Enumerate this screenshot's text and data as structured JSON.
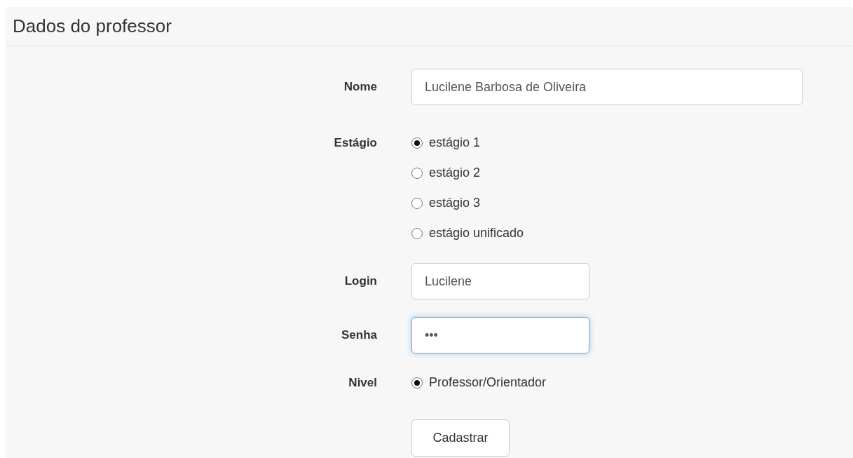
{
  "panel": {
    "title": "Dados do professor"
  },
  "fields": [
    {
      "kind": "text",
      "label": "Nome",
      "value": "Lucilene Barbosa de Oliveira",
      "focused": false,
      "wide": true
    },
    {
      "kind": "radio",
      "label": "Estágio",
      "options": [
        {
          "label": "estágio 1",
          "selected": true
        },
        {
          "label": "estágio 2",
          "selected": false
        },
        {
          "label": "estágio 3",
          "selected": false
        },
        {
          "label": "estágio unificado",
          "selected": false
        }
      ]
    },
    {
      "kind": "text",
      "label": "Login",
      "value": "Lucilene",
      "focused": false,
      "wide": false
    },
    {
      "kind": "text",
      "label": "Senha",
      "value": "•••",
      "focused": true,
      "wide": false
    },
    {
      "kind": "radio",
      "label": "Nivel",
      "options": [
        {
          "label": "Professor/Orientador",
          "selected": true
        }
      ]
    }
  ],
  "submit": {
    "label": "Cadastrar"
  }
}
